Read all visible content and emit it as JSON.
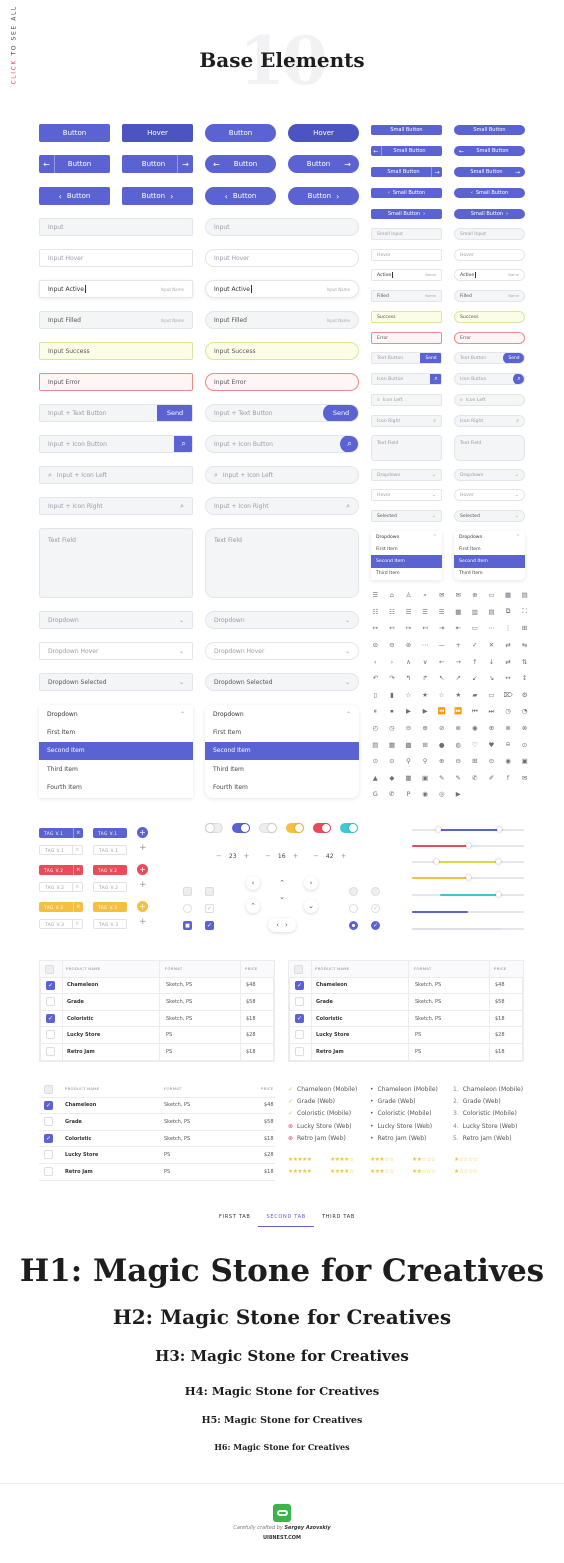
{
  "side_label": {
    "a": "CLICK",
    "b": " TO SEE ALL"
  },
  "header": {
    "number": "10",
    "title": "Base Elements"
  },
  "buttons": {
    "button": "Button",
    "hover": "Hover",
    "small": "Small Button"
  },
  "inputs": {
    "input": "Input",
    "hover": "Input Hover",
    "active": "Input Active",
    "filled": "Input Filled",
    "success": "Input Success",
    "error": "Input Error",
    "text_button": "Input + Text Button",
    "icon_button": "Input + Icon Button",
    "icon_left": "Input + Icon Left",
    "icon_right": "Input + Icon Right",
    "text_field": "Text Field",
    "name": "Input Name",
    "send": "Send"
  },
  "small_inputs": {
    "input": "Small Input",
    "hover": "Hover",
    "active": "Active",
    "filled": "Filled",
    "success": "Success",
    "error": "Error",
    "text_button": "Text Button",
    "icon_button": "Icon Button",
    "icon_left": "Icon Left",
    "icon_right": "Icon Right",
    "text_field": "Text Field",
    "name": "Name",
    "send": "Send"
  },
  "dropdowns": {
    "dropdown": "Dropdown",
    "hover": "Dropdown Hover",
    "selected": "Dropdown Selected",
    "items": [
      "First Item",
      "Second Item",
      "Third Item",
      "Fourth Item"
    ]
  },
  "small_dropdowns": {
    "dropdown": "Dropdown",
    "hover": "Hover",
    "selected": "Selected",
    "items": [
      "First Item",
      "Second Item",
      "Third Item"
    ]
  },
  "tags": {
    "v1": "TAG V.1",
    "v2": "TAG V.2",
    "v3": "TAG V.3"
  },
  "colors": {
    "accent": "#5b63d3",
    "red": "#ea4b5a",
    "yellow": "#f5c042",
    "cyan": "#3fc7d6",
    "green": "#2fb84a"
  },
  "steppers": [
    "23",
    "16",
    "42"
  ],
  "table": {
    "headers": [
      "PRODUCT NAME",
      "FORMAT",
      "PRICE"
    ],
    "rows": [
      [
        "Chameleon",
        "Sketch, PS",
        "$48"
      ],
      [
        "Grade",
        "Sketch, PS",
        "$58"
      ],
      [
        "Coloristic",
        "Sketch, PS",
        "$18"
      ],
      [
        "Lucky Store",
        "PS",
        "$28"
      ],
      [
        "Retro Jam",
        "PS",
        "$18"
      ]
    ]
  },
  "lists": {
    "status": [
      "Chameleon (Mobile)",
      "Grade (Web)",
      "Coloristic (Mobile)",
      "Lucky Store (Web)",
      "Retro Jam (Web)"
    ],
    "numbers": [
      "1.",
      "2.",
      "3.",
      "4.",
      "5."
    ]
  },
  "tabs": [
    "FIRST TAB",
    "SECOND TAB",
    "THIRD TAB"
  ],
  "headings": {
    "h1": "H1: Magic Stone for Creatives",
    "h2": "H2: Magic Stone for Creatives",
    "h3": "H3: Magic Stone for Creatives",
    "h4": "H4: Magic Stone for Creatives",
    "h5": "H5: Magic Stone for Creatives",
    "h6": "H6: Magic Stone for Creatives"
  },
  "footer": {
    "crafted": "Carefully crafted by",
    "author": "Sergey Azovskiy",
    "site": "UI8NEST.COM"
  },
  "icons": [
    "☰",
    "⌂",
    "♙",
    "⌕",
    "✉",
    "✉",
    "⊕",
    "▭",
    "▦",
    "▤",
    "☷",
    "☷",
    "☰",
    "☰",
    "☰",
    "▦",
    "▥",
    "▤",
    "⧉",
    "⛶",
    "↦",
    "↤",
    "↦",
    "↤",
    "⇥",
    "⇤",
    "▭",
    "⋯",
    "⋮",
    "⊞",
    "⊘",
    "⊖",
    "⊛",
    "⋯",
    "—",
    "+",
    "✓",
    "✕",
    "⇄",
    "⇆",
    "‹",
    "›",
    "∧",
    "∨",
    "←",
    "→",
    "↑",
    "↓",
    "⇄",
    "⇅",
    "↶",
    "↷",
    "↰",
    "↱",
    "↖",
    "↗",
    "↙",
    "↘",
    "↔",
    "↕",
    "▯",
    "▮",
    "☆",
    "★",
    "☆",
    "★",
    "▰",
    "▭",
    "⌦",
    "⚙",
    "⏸",
    "⏹",
    "▶",
    "▶",
    "⏪",
    "⏩",
    "⏮",
    "⏭",
    "◷",
    "◔",
    "◴",
    "◷",
    "⊖",
    "⊕",
    "⊘",
    "⊗",
    "◉",
    "⊕",
    "⊗",
    "⊗",
    "▤",
    "▦",
    "▩",
    "⊞",
    "●",
    "◍",
    "♡",
    "♥",
    "⍾",
    "⊙",
    "⊙",
    "⊙",
    "⚲",
    "⚲",
    "⊕",
    "⊖",
    "⊞",
    "⊝",
    "◉",
    "▣",
    "▲",
    "◆",
    "▦",
    "▣",
    "✎",
    "✎",
    "✆",
    "✐",
    "f",
    "✉",
    "G",
    "✆",
    "P",
    "◉",
    "◎",
    "▶"
  ]
}
